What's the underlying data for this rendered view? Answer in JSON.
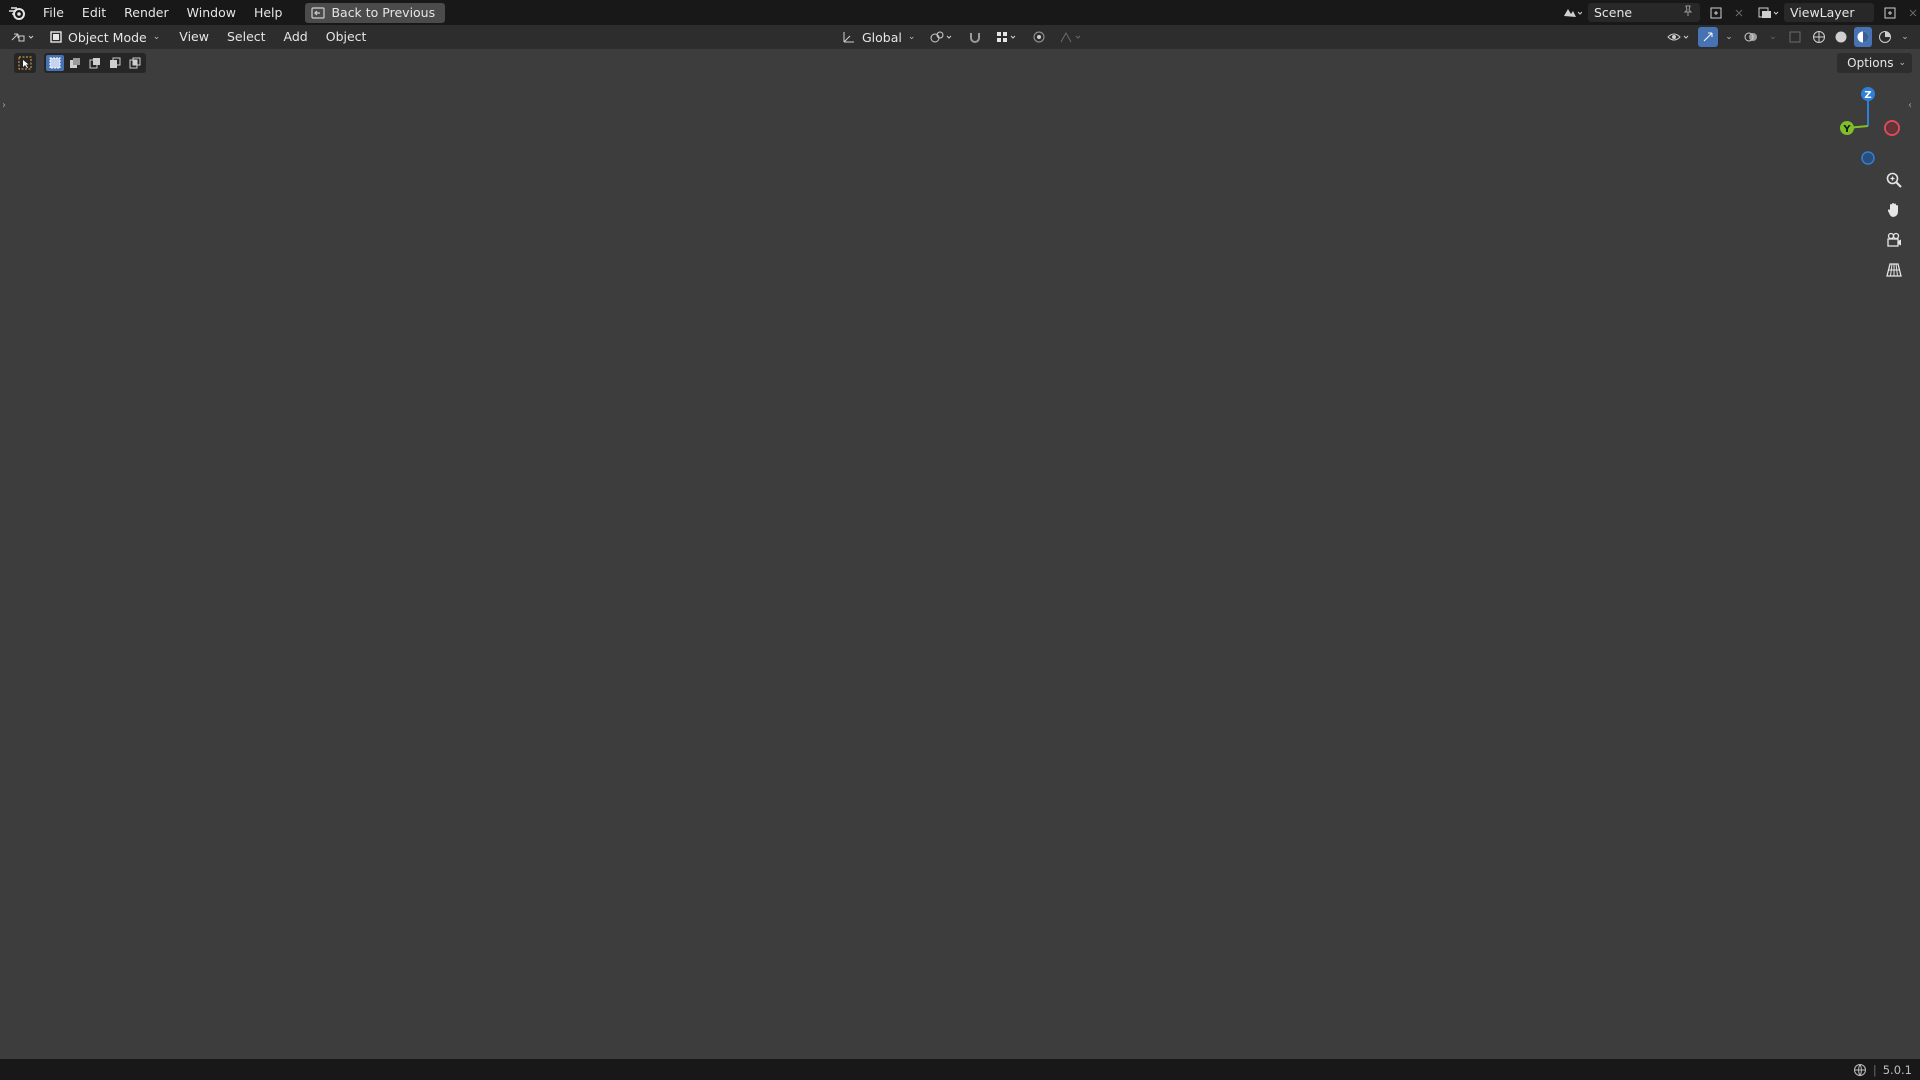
{
  "topbar": {
    "menu": [
      "File",
      "Edit",
      "Render",
      "Window",
      "Help"
    ],
    "back_label": "Back to Previous",
    "scene_label": "Scene",
    "viewlayer_label": "ViewLayer"
  },
  "header": {
    "mode_label": "Object Mode",
    "menus": [
      "View",
      "Select",
      "Add",
      "Object"
    ],
    "transform_orientation": "Global"
  },
  "toolrow": {
    "options_label": "Options"
  },
  "gizmo": {
    "z_label": "Z",
    "y_label": "Y",
    "colors": {
      "x": "#e04a56",
      "y": "#7fbf2a",
      "z": "#2d7fd8"
    }
  },
  "scene_objects": {
    "flag_color": "#c41818",
    "pole_color": "#c8cbd0",
    "cup_color": "#b9bdc2"
  },
  "statusbar": {
    "version": "5.0.1"
  }
}
